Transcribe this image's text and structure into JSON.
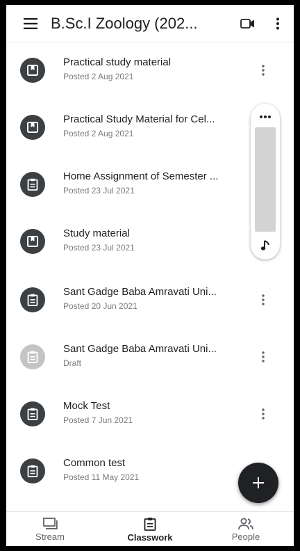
{
  "app_bar": {
    "title": "B.Sc.I Zoology (202...",
    "menu_icon": "hamburger-menu-icon",
    "video_icon": "video-camera-icon",
    "more_icon": "more-vert-icon"
  },
  "items": [
    {
      "title": "Practical study material",
      "subtitle": "Posted 2 Aug 2021",
      "icon": "material-icon",
      "draft": false,
      "has_more": true
    },
    {
      "title": "Practical Study Material for Cel...",
      "subtitle": "Posted 2 Aug 2021",
      "icon": "material-icon",
      "draft": false,
      "has_more": false
    },
    {
      "title": "Home Assignment of Semester ...",
      "subtitle": "Posted 23 Jul 2021",
      "icon": "assignment-icon",
      "draft": false,
      "has_more": false
    },
    {
      "title": "Study material",
      "subtitle": "Posted 23 Jul 2021",
      "icon": "material-icon",
      "draft": false,
      "has_more": false
    },
    {
      "title": "Sant Gadge Baba Amravati Uni...",
      "subtitle": "Posted 20 Jun 2021",
      "icon": "assignment-icon",
      "draft": false,
      "has_more": true
    },
    {
      "title": "Sant Gadge Baba Amravati Uni...",
      "subtitle": "Draft",
      "icon": "assignment-icon",
      "draft": true,
      "has_more": true
    },
    {
      "title": "Mock Test",
      "subtitle": "Posted 7 Jun 2021",
      "icon": "assignment-icon",
      "draft": false,
      "has_more": true
    },
    {
      "title": "Common test",
      "subtitle": "Posted 11 May 2021",
      "icon": "assignment-icon",
      "draft": false,
      "has_more": false
    }
  ],
  "fab": {
    "icon": "add-icon"
  },
  "bottom_nav": [
    {
      "label": "Stream",
      "icon": "stream-icon",
      "active": false
    },
    {
      "label": "Classwork",
      "icon": "classwork-icon",
      "active": true
    },
    {
      "label": "People",
      "icon": "people-icon",
      "active": false
    }
  ],
  "colors": {
    "icon_dark": "#3c4043",
    "icon_draft": "#c4c4c4",
    "fab": "#202124"
  }
}
